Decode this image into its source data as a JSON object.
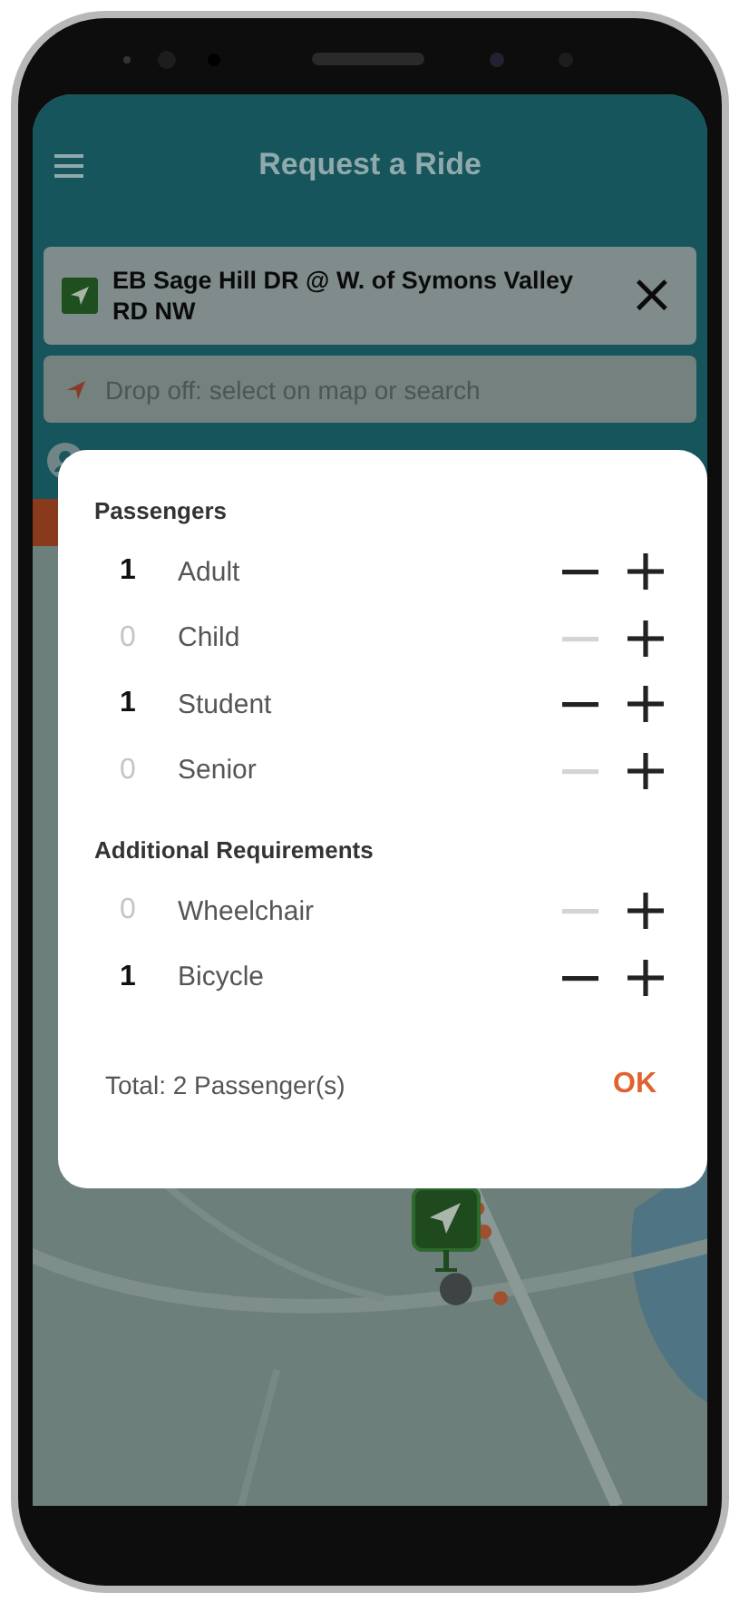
{
  "header": {
    "title": "Request a Ride",
    "pickup": {
      "value": "EB Sage Hill DR @ W. of Symons Valley RD NW",
      "clear": "×"
    },
    "dropoff": {
      "placeholder": "Drop off: select on map or search"
    }
  },
  "dialog": {
    "sections": [
      {
        "title": "Passengers",
        "rows": [
          {
            "count": "1",
            "label": "Adult",
            "disabled": false
          },
          {
            "count": "0",
            "label": "Child",
            "disabled": true
          },
          {
            "count": "1",
            "label": "Student",
            "disabled": false
          },
          {
            "count": "0",
            "label": "Senior",
            "disabled": true
          }
        ]
      },
      {
        "title": "Additional Requirements",
        "rows": [
          {
            "count": "0",
            "label": "Wheelchair",
            "disabled": true
          },
          {
            "count": "1",
            "label": "Bicycle",
            "disabled": false
          }
        ]
      }
    ],
    "total": "Total: 2 Passenger(s)",
    "ok": "OK"
  }
}
